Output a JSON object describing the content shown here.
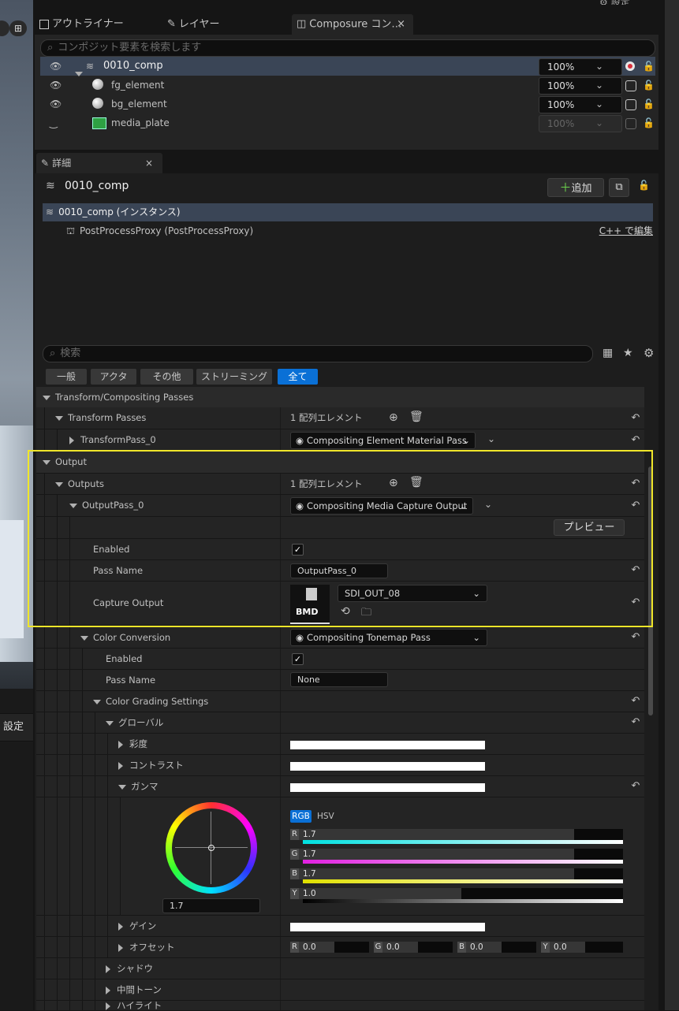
{
  "tabs": [
    {
      "label": "アウトライナー",
      "icon": "list-icon"
    },
    {
      "label": "レイヤー",
      "icon": "layers-icon"
    },
    {
      "label": "Composure コン…",
      "icon": "composure-icon"
    }
  ],
  "top_right_partial": "設定",
  "viewport_side": {
    "settings_label": "設定"
  },
  "outliner": {
    "search_placeholder": "コンポジット要素を検索します",
    "rows": [
      {
        "name": "0010_comp",
        "opacity": "100%"
      },
      {
        "name": "fg_element",
        "opacity": "100%"
      },
      {
        "name": "bg_element",
        "opacity": "100%"
      },
      {
        "name": "media_plate",
        "opacity": "100%"
      }
    ]
  },
  "details": {
    "tab_label": "詳細",
    "title": "0010_comp",
    "add_label": "追加",
    "components": [
      {
        "label": "0010_comp (インスタンス)"
      },
      {
        "label": "PostProcessProxy (PostProcessProxy)",
        "link": "C++ で編集"
      }
    ],
    "search_placeholder": "検索",
    "categories": [
      "一般",
      "アクタ",
      "その他",
      "ストリーミング",
      "全て"
    ]
  },
  "props": {
    "transform_section": "Transform/Compositing Passes",
    "transform_passes": "Transform Passes",
    "array_elements_1": "1 配列エレメント",
    "transform_pass_0": "TransformPass_0",
    "transform_pass_value": "Compositing Element Material Pass",
    "output_section": "Output",
    "outputs": "Outputs",
    "array_elements_2": "1 配列エレメント",
    "output_pass_0": "OutputPass_0",
    "output_pass_value": "Compositing Media Capture Output",
    "preview_label": "プレビュー",
    "enabled_label": "Enabled",
    "pass_name_label": "Pass Name",
    "pass_name_value": "OutputPass_0",
    "capture_output_label": "Capture Output",
    "capture_output_value": "SDI_OUT_08",
    "capture_thumb_text": "BMD",
    "color_conversion": "Color Conversion",
    "color_conversion_value": "Compositing Tonemap Pass",
    "enabled_label_2": "Enabled",
    "pass_name_label_2": "Pass Name",
    "pass_name_value_2": "None",
    "color_grading": "Color Grading Settings",
    "global": "グローバル",
    "saturation": "彩度",
    "contrast": "コントラスト",
    "gamma": "ガンマ",
    "rgb_tab": "RGB",
    "hsv_tab": "HSV",
    "wheel_value": "1.7",
    "channels": [
      {
        "ch": "R",
        "value": "1.7",
        "fill": 0.85
      },
      {
        "ch": "G",
        "value": "1.7",
        "fill": 0.85
      },
      {
        "ch": "B",
        "value": "1.7",
        "fill": 0.85
      },
      {
        "ch": "Y",
        "value": "1.0",
        "fill": 0.5
      }
    ],
    "gain": "ゲイン",
    "offset": "オフセット",
    "offset_values": [
      {
        "ch": "R",
        "value": "0.0"
      },
      {
        "ch": "G",
        "value": "0.0"
      },
      {
        "ch": "B",
        "value": "0.0"
      },
      {
        "ch": "Y",
        "value": "0.0"
      }
    ],
    "shadows": "シャドウ",
    "midtones": "中間トーン",
    "highlights": "ハイライト"
  },
  "colors": {
    "accent": "#0a70d6",
    "highlight": "#f0e62a",
    "selected_row": "#3a4556"
  }
}
